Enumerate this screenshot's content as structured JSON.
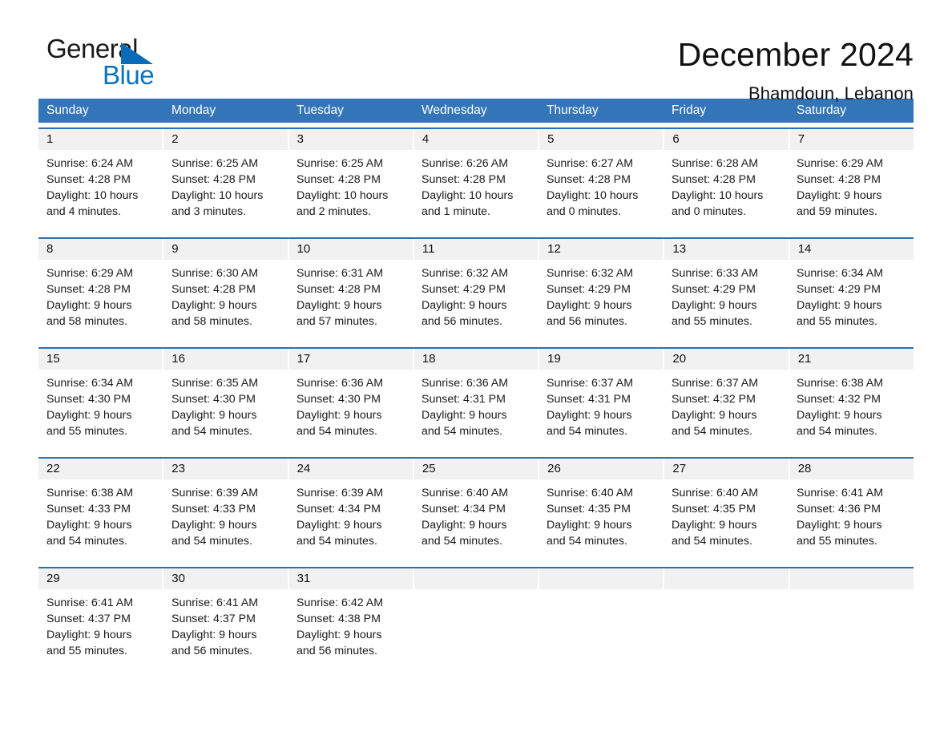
{
  "brand": {
    "name_top": "General",
    "name_bottom": "Blue",
    "triangle_color": "#0a6cb8",
    "blue_text_color": "#0a74c4"
  },
  "header": {
    "month_title": "December 2024",
    "location": "Bhamdoun, Lebanon"
  },
  "colors": {
    "header_blue": "#3275b8",
    "row_divider_blue": "#2f6fae",
    "daynum_band": "#f1f1f1",
    "text": "#1a1a1a"
  },
  "calendar": {
    "day_headers": [
      "Sunday",
      "Monday",
      "Tuesday",
      "Wednesday",
      "Thursday",
      "Friday",
      "Saturday"
    ],
    "weeks": [
      {
        "days": [
          {
            "num": "1",
            "sunrise": "Sunrise: 6:24 AM",
            "sunset": "Sunset: 4:28 PM",
            "daylight1": "Daylight: 10 hours",
            "daylight2": "and 4 minutes."
          },
          {
            "num": "2",
            "sunrise": "Sunrise: 6:25 AM",
            "sunset": "Sunset: 4:28 PM",
            "daylight1": "Daylight: 10 hours",
            "daylight2": "and 3 minutes."
          },
          {
            "num": "3",
            "sunrise": "Sunrise: 6:25 AM",
            "sunset": "Sunset: 4:28 PM",
            "daylight1": "Daylight: 10 hours",
            "daylight2": "and 2 minutes."
          },
          {
            "num": "4",
            "sunrise": "Sunrise: 6:26 AM",
            "sunset": "Sunset: 4:28 PM",
            "daylight1": "Daylight: 10 hours",
            "daylight2": "and 1 minute."
          },
          {
            "num": "5",
            "sunrise": "Sunrise: 6:27 AM",
            "sunset": "Sunset: 4:28 PM",
            "daylight1": "Daylight: 10 hours",
            "daylight2": "and 0 minutes."
          },
          {
            "num": "6",
            "sunrise": "Sunrise: 6:28 AM",
            "sunset": "Sunset: 4:28 PM",
            "daylight1": "Daylight: 10 hours",
            "daylight2": "and 0 minutes."
          },
          {
            "num": "7",
            "sunrise": "Sunrise: 6:29 AM",
            "sunset": "Sunset: 4:28 PM",
            "daylight1": "Daylight: 9 hours",
            "daylight2": "and 59 minutes."
          }
        ]
      },
      {
        "days": [
          {
            "num": "8",
            "sunrise": "Sunrise: 6:29 AM",
            "sunset": "Sunset: 4:28 PM",
            "daylight1": "Daylight: 9 hours",
            "daylight2": "and 58 minutes."
          },
          {
            "num": "9",
            "sunrise": "Sunrise: 6:30 AM",
            "sunset": "Sunset: 4:28 PM",
            "daylight1": "Daylight: 9 hours",
            "daylight2": "and 58 minutes."
          },
          {
            "num": "10",
            "sunrise": "Sunrise: 6:31 AM",
            "sunset": "Sunset: 4:28 PM",
            "daylight1": "Daylight: 9 hours",
            "daylight2": "and 57 minutes."
          },
          {
            "num": "11",
            "sunrise": "Sunrise: 6:32 AM",
            "sunset": "Sunset: 4:29 PM",
            "daylight1": "Daylight: 9 hours",
            "daylight2": "and 56 minutes."
          },
          {
            "num": "12",
            "sunrise": "Sunrise: 6:32 AM",
            "sunset": "Sunset: 4:29 PM",
            "daylight1": "Daylight: 9 hours",
            "daylight2": "and 56 minutes."
          },
          {
            "num": "13",
            "sunrise": "Sunrise: 6:33 AM",
            "sunset": "Sunset: 4:29 PM",
            "daylight1": "Daylight: 9 hours",
            "daylight2": "and 55 minutes."
          },
          {
            "num": "14",
            "sunrise": "Sunrise: 6:34 AM",
            "sunset": "Sunset: 4:29 PM",
            "daylight1": "Daylight: 9 hours",
            "daylight2": "and 55 minutes."
          }
        ]
      },
      {
        "days": [
          {
            "num": "15",
            "sunrise": "Sunrise: 6:34 AM",
            "sunset": "Sunset: 4:30 PM",
            "daylight1": "Daylight: 9 hours",
            "daylight2": "and 55 minutes."
          },
          {
            "num": "16",
            "sunrise": "Sunrise: 6:35 AM",
            "sunset": "Sunset: 4:30 PM",
            "daylight1": "Daylight: 9 hours",
            "daylight2": "and 54 minutes."
          },
          {
            "num": "17",
            "sunrise": "Sunrise: 6:36 AM",
            "sunset": "Sunset: 4:30 PM",
            "daylight1": "Daylight: 9 hours",
            "daylight2": "and 54 minutes."
          },
          {
            "num": "18",
            "sunrise": "Sunrise: 6:36 AM",
            "sunset": "Sunset: 4:31 PM",
            "daylight1": "Daylight: 9 hours",
            "daylight2": "and 54 minutes."
          },
          {
            "num": "19",
            "sunrise": "Sunrise: 6:37 AM",
            "sunset": "Sunset: 4:31 PM",
            "daylight1": "Daylight: 9 hours",
            "daylight2": "and 54 minutes."
          },
          {
            "num": "20",
            "sunrise": "Sunrise: 6:37 AM",
            "sunset": "Sunset: 4:32 PM",
            "daylight1": "Daylight: 9 hours",
            "daylight2": "and 54 minutes."
          },
          {
            "num": "21",
            "sunrise": "Sunrise: 6:38 AM",
            "sunset": "Sunset: 4:32 PM",
            "daylight1": "Daylight: 9 hours",
            "daylight2": "and 54 minutes."
          }
        ]
      },
      {
        "days": [
          {
            "num": "22",
            "sunrise": "Sunrise: 6:38 AM",
            "sunset": "Sunset: 4:33 PM",
            "daylight1": "Daylight: 9 hours",
            "daylight2": "and 54 minutes."
          },
          {
            "num": "23",
            "sunrise": "Sunrise: 6:39 AM",
            "sunset": "Sunset: 4:33 PM",
            "daylight1": "Daylight: 9 hours",
            "daylight2": "and 54 minutes."
          },
          {
            "num": "24",
            "sunrise": "Sunrise: 6:39 AM",
            "sunset": "Sunset: 4:34 PM",
            "daylight1": "Daylight: 9 hours",
            "daylight2": "and 54 minutes."
          },
          {
            "num": "25",
            "sunrise": "Sunrise: 6:40 AM",
            "sunset": "Sunset: 4:34 PM",
            "daylight1": "Daylight: 9 hours",
            "daylight2": "and 54 minutes."
          },
          {
            "num": "26",
            "sunrise": "Sunrise: 6:40 AM",
            "sunset": "Sunset: 4:35 PM",
            "daylight1": "Daylight: 9 hours",
            "daylight2": "and 54 minutes."
          },
          {
            "num": "27",
            "sunrise": "Sunrise: 6:40 AM",
            "sunset": "Sunset: 4:35 PM",
            "daylight1": "Daylight: 9 hours",
            "daylight2": "and 54 minutes."
          },
          {
            "num": "28",
            "sunrise": "Sunrise: 6:41 AM",
            "sunset": "Sunset: 4:36 PM",
            "daylight1": "Daylight: 9 hours",
            "daylight2": "and 55 minutes."
          }
        ]
      },
      {
        "days": [
          {
            "num": "29",
            "sunrise": "Sunrise: 6:41 AM",
            "sunset": "Sunset: 4:37 PM",
            "daylight1": "Daylight: 9 hours",
            "daylight2": "and 55 minutes."
          },
          {
            "num": "30",
            "sunrise": "Sunrise: 6:41 AM",
            "sunset": "Sunset: 4:37 PM",
            "daylight1": "Daylight: 9 hours",
            "daylight2": "and 56 minutes."
          },
          {
            "num": "31",
            "sunrise": "Sunrise: 6:42 AM",
            "sunset": "Sunset: 4:38 PM",
            "daylight1": "Daylight: 9 hours",
            "daylight2": "and 56 minutes."
          },
          {
            "num": "",
            "sunrise": "",
            "sunset": "",
            "daylight1": "",
            "daylight2": ""
          },
          {
            "num": "",
            "sunrise": "",
            "sunset": "",
            "daylight1": "",
            "daylight2": ""
          },
          {
            "num": "",
            "sunrise": "",
            "sunset": "",
            "daylight1": "",
            "daylight2": ""
          },
          {
            "num": "",
            "sunrise": "",
            "sunset": "",
            "daylight1": "",
            "daylight2": ""
          }
        ]
      }
    ]
  }
}
